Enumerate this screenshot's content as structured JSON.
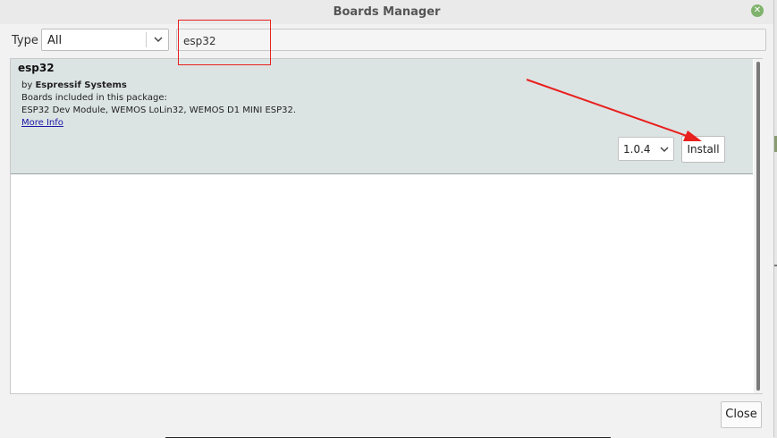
{
  "window": {
    "title": "Boards Manager"
  },
  "filter": {
    "type_label": "Type",
    "type_value": "All",
    "search_value": "esp32"
  },
  "packages": [
    {
      "name": "esp32",
      "by_prefix": "by",
      "author": "Espressif Systems",
      "included_label": "Boards included in this package:",
      "boards": "ESP32 Dev Module, WEMOS LoLin32, WEMOS D1 MINI ESP32.",
      "more_info": "More Info",
      "version": "1.0.4",
      "install_label": "Install"
    }
  ],
  "footer": {
    "close_label": "Close"
  },
  "annotations": {
    "color": "#e8201e"
  },
  "icons": {
    "window_close": "close-icon",
    "dropdown": "chevron-down-icon"
  }
}
